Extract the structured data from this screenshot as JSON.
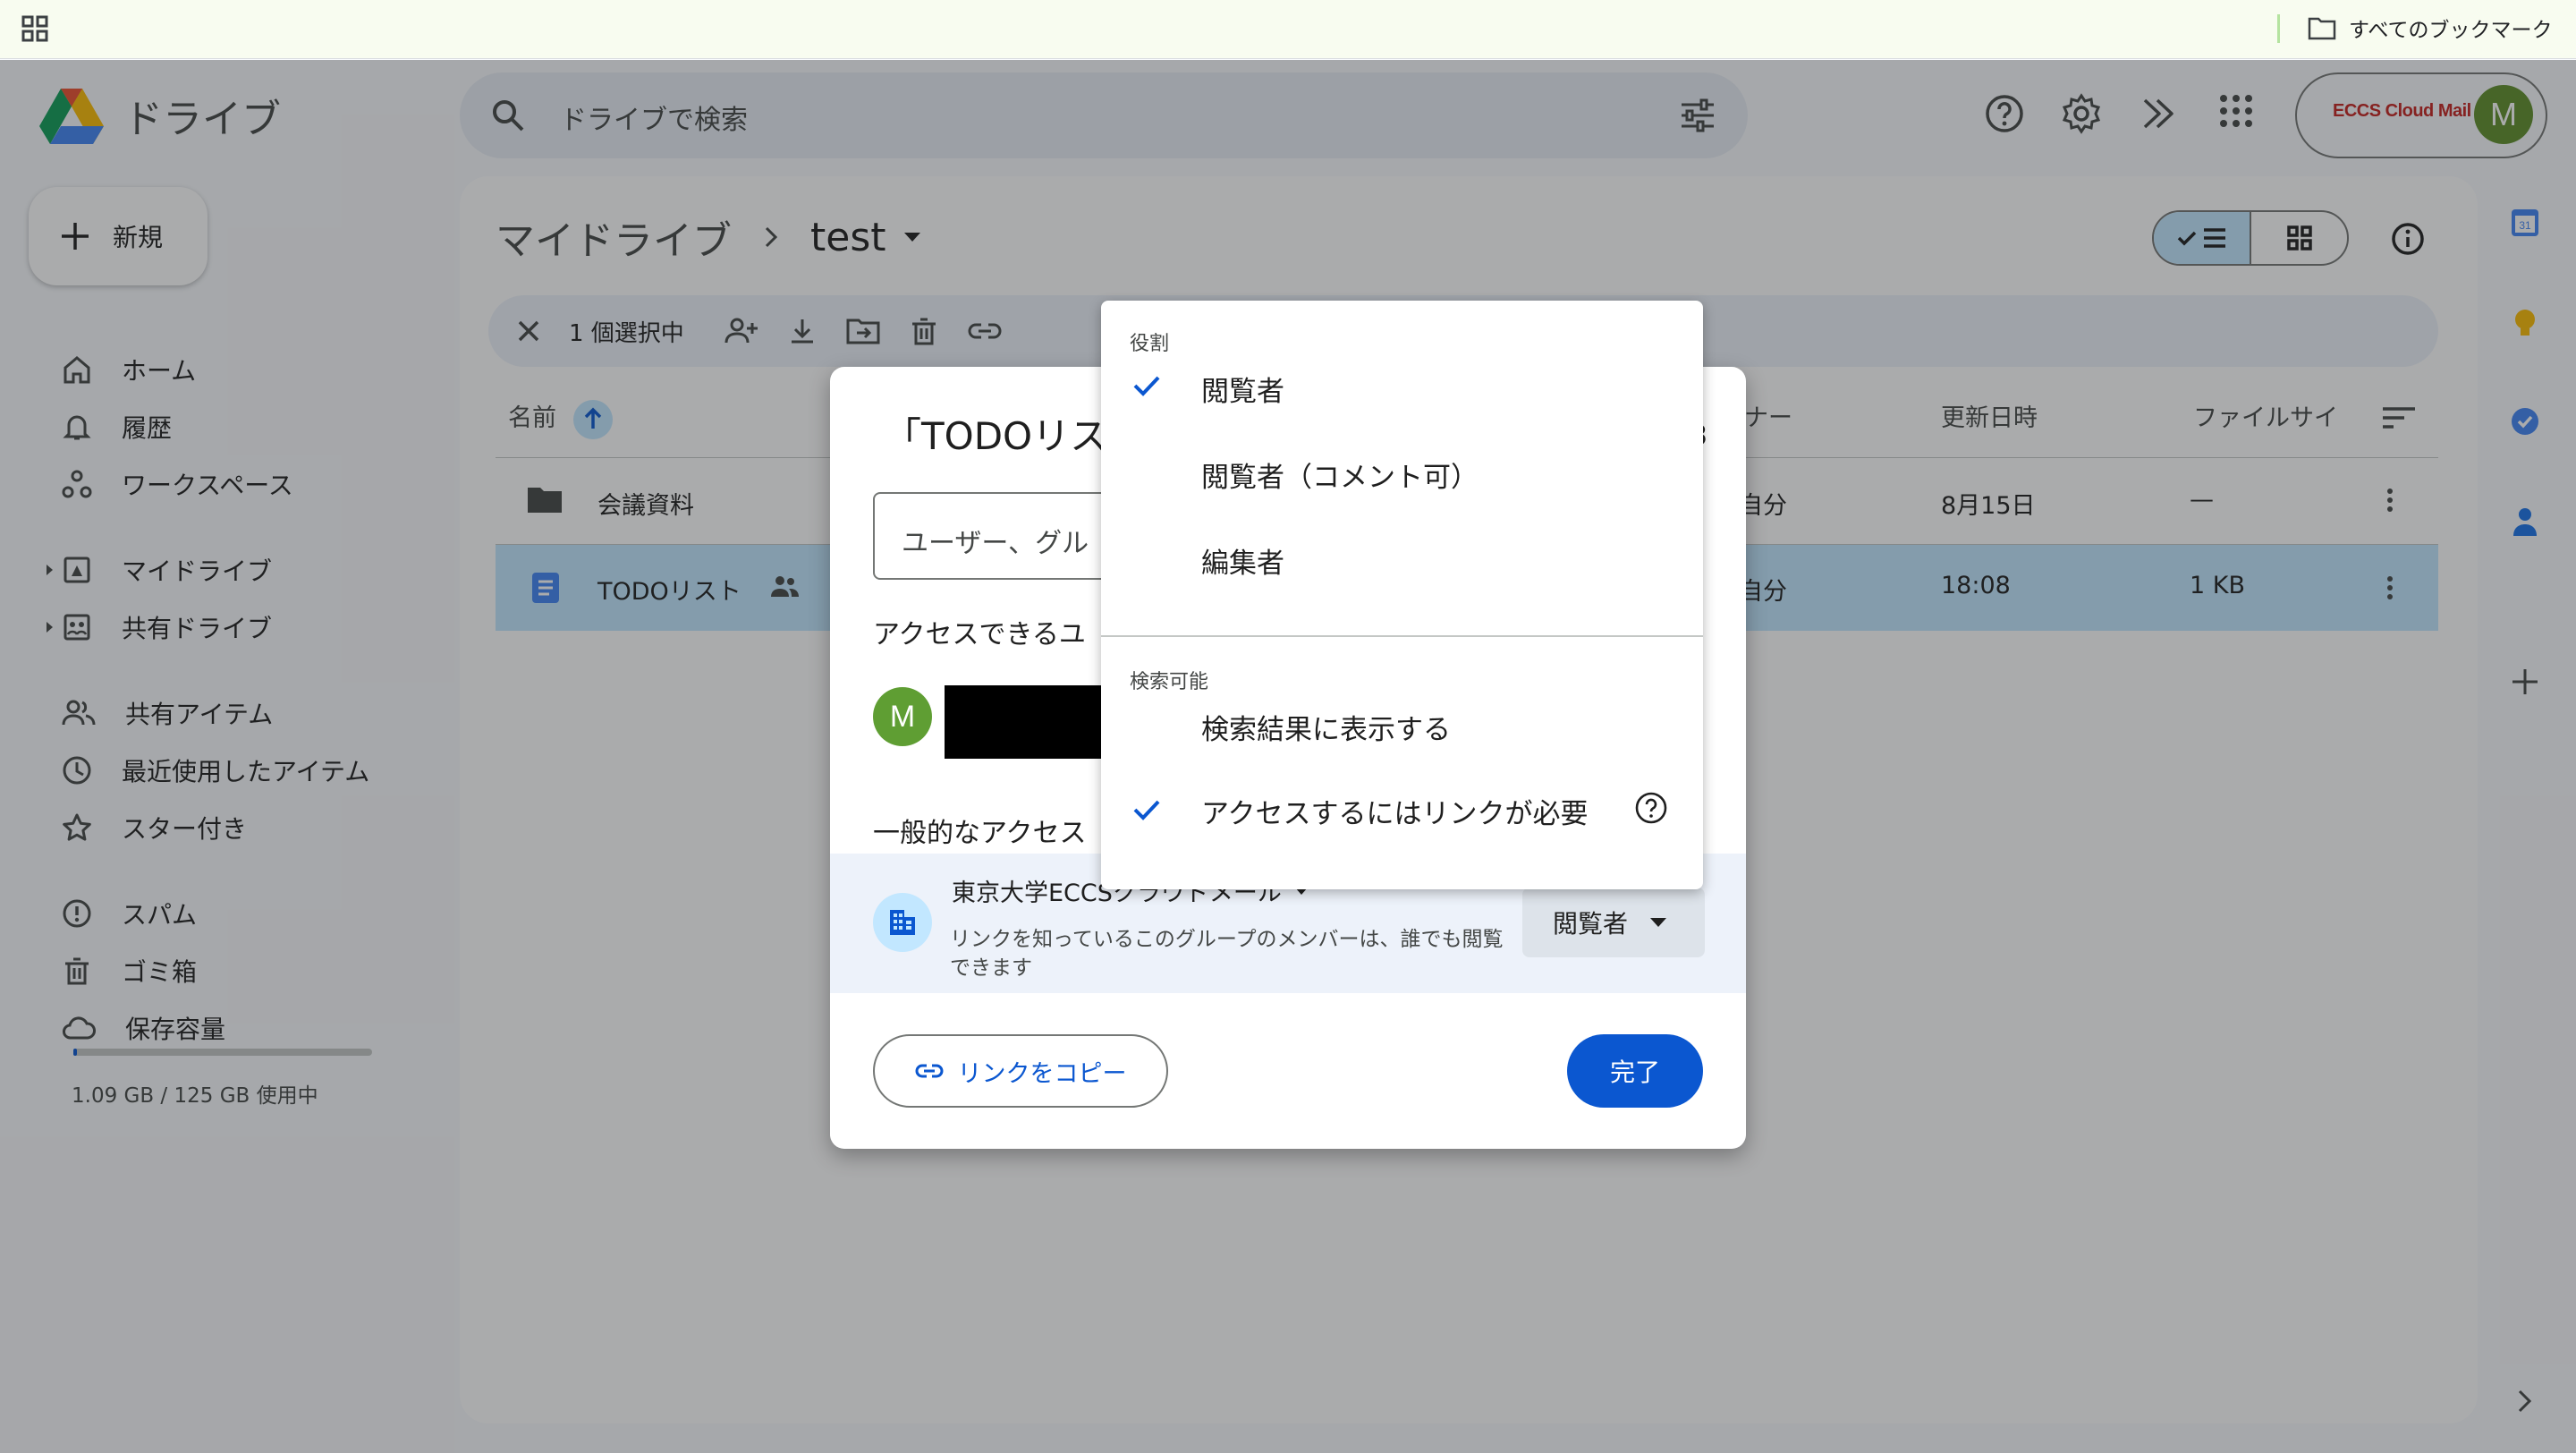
{
  "bookmarks_bar": {
    "all_bookmarks": "すべてのブックマーク"
  },
  "header": {
    "app_name": "ドライブ",
    "search_placeholder": "ドライブで検索",
    "account_logo": "ECCS Cloud Mail",
    "avatar_initial": "M"
  },
  "sidebar": {
    "new_label": "新規",
    "items": [
      {
        "label": "ホーム",
        "icon": "home-icon"
      },
      {
        "label": "履歴",
        "icon": "bell-icon"
      },
      {
        "label": "ワークスペース",
        "icon": "workspace-icon"
      },
      {
        "label": "マイドライブ",
        "icon": "my-drive-icon"
      },
      {
        "label": "共有ドライブ",
        "icon": "shared-drive-icon"
      },
      {
        "label": "共有アイテム",
        "icon": "people-icon"
      },
      {
        "label": "最近使用したアイテム",
        "icon": "clock-icon"
      },
      {
        "label": "スター付き",
        "icon": "star-icon"
      },
      {
        "label": "スパム",
        "icon": "spam-icon"
      },
      {
        "label": "ゴミ箱",
        "icon": "trash-icon"
      },
      {
        "label": "保存容量",
        "icon": "cloud-icon"
      }
    ],
    "storage_text": "1.09 GB / 125 GB 使用中",
    "storage_used_fraction": 0.0087
  },
  "main": {
    "breadcrumb": {
      "root": "マイドライブ",
      "current": "test"
    },
    "action_bar": {
      "count_label": "1 個選択中"
    },
    "columns": {
      "name": "名前",
      "owner": "ナー",
      "modified": "更新日時",
      "size": "ファイルサイ"
    },
    "rows": [
      {
        "name": "会議資料",
        "owner": "自分",
        "modified": "8月15日",
        "size": "—"
      },
      {
        "name": "TODOリスト",
        "owner": "自分",
        "modified": "18:08",
        "size": "1 KB"
      }
    ]
  },
  "dialog": {
    "title": "「TODOリス",
    "title_suffix": "3",
    "input_placeholder": "ユーザー、グル",
    "people_heading": "アクセスできるユ",
    "person_initial": "M",
    "general_access_heading": "一般的なアクセス",
    "org_name": "東京大学ECCSクラウドメール",
    "org_desc": "リンクを知っているこのグループのメンバーは、誰でも閲覧できます",
    "role": "閲覧者",
    "copy_link": "リンクをコピー",
    "done": "完了"
  },
  "menu": {
    "role_heading": "役割",
    "roles": [
      {
        "label": "閲覧者",
        "checked": true
      },
      {
        "label": "閲覧者（コメント可）",
        "checked": false
      },
      {
        "label": "編集者",
        "checked": false
      }
    ],
    "searchable_heading": "検索可能",
    "search_options": [
      {
        "label": "検索結果に表示する",
        "checked": false
      },
      {
        "label": "アクセスするにはリンクが必要",
        "checked": true
      }
    ]
  },
  "colors": {
    "accent": "#0b57d0",
    "selected_row": "#c2e7ff",
    "scrim": "rgba(32,33,36,0.38)"
  }
}
